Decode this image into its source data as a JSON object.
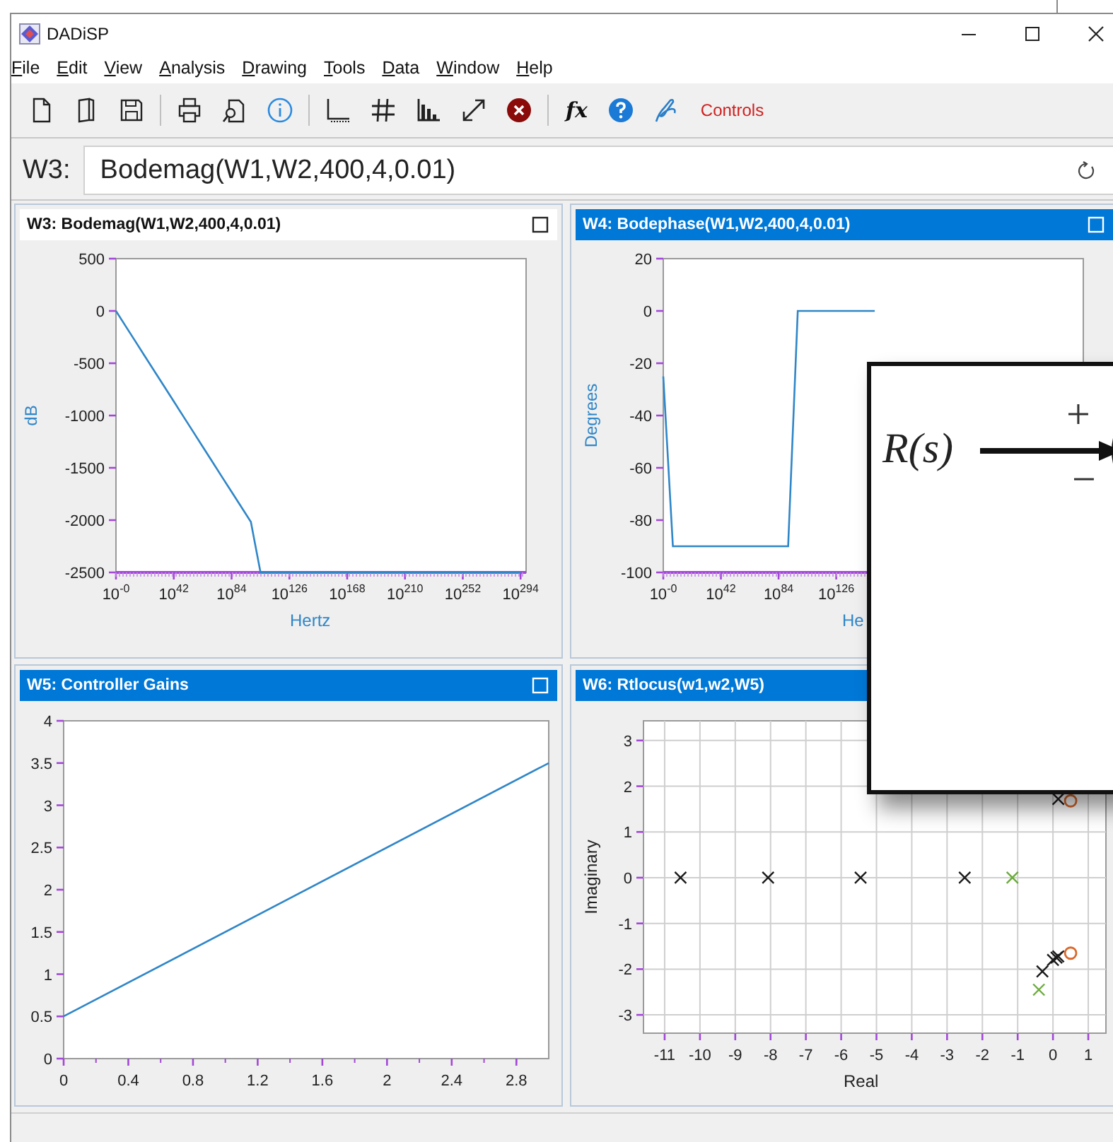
{
  "window": {
    "title": "DADiSP"
  },
  "menu": [
    "File",
    "Edit",
    "View",
    "Analysis",
    "Drawing",
    "Tools",
    "Data",
    "Window",
    "Help"
  ],
  "toolbar": {
    "function_label": "fx",
    "controls_label": "Controls"
  },
  "formula_bar": {
    "label": "W3:",
    "value": "Bodemag(W1,W2,400,4,0.01)"
  },
  "panes": [
    {
      "title": "W3: Bodemag(W1,W2,400,4,0.01)",
      "selected": true,
      "maximize_button": true,
      "chart_data": {
        "type": "line",
        "xlabel": "Hertz",
        "ylabel": "dB",
        "categories": [
          "10$^{-0}$",
          null,
          null,
          null,
          null,
          null,
          "10$^{42}$",
          null,
          null,
          null,
          null,
          null,
          "10$^{84}$",
          null,
          null,
          null,
          null,
          null,
          "10$^{126}$",
          null,
          null,
          null,
          null,
          null,
          "10$^{168}$",
          null,
          null,
          null,
          null,
          null,
          "10$^{210}$",
          null,
          null,
          null,
          null,
          null,
          "10$^{252}$",
          null,
          null,
          null,
          null,
          null,
          "10$^{294}$"
        ],
        "series": [
          {
            "color": "#2f86c8",
            "values": [
              0,
              -144,
              -288,
              -432,
              -576,
              -721,
              -865,
              -1009,
              -1153,
              -1297,
              -1441,
              -1585,
              -1729,
              -1873,
              -2017,
              -2500,
              -2500,
              -2500,
              -2500,
              -2500,
              -2500,
              -2500,
              -2500,
              -2500,
              -2500,
              -2500,
              -2500,
              -2500,
              -2500,
              -2500,
              -2500,
              -2500,
              -2500,
              -2500,
              -2500,
              -2500,
              -2500,
              -2500,
              -2500,
              -2500,
              -2500,
              -2500,
              -2500
            ]
          }
        ],
        "ylim": [
          -2500,
          500
        ],
        "yticks": [
          500,
          0,
          -500,
          -1000,
          -1500,
          -2000,
          -2500
        ]
      }
    },
    {
      "title": "W4: Bodephase(W1,W2,400,4,0.01)",
      "selected": false,
      "maximize_button": true,
      "chart_data": {
        "type": "line",
        "xlabel": "He",
        "ylabel": "Degrees",
        "categories": [
          "10$^{-0}$",
          null,
          null,
          null,
          null,
          null,
          "10$^{42}$",
          null,
          null,
          null,
          null,
          null,
          "10$^{84}$",
          null,
          null,
          null,
          null,
          null,
          "10$^{126}$",
          null,
          null,
          null,
          null,
          null,
          null,
          null,
          null,
          null,
          null,
          null,
          null,
          null,
          null,
          null,
          null,
          null,
          null,
          null,
          null,
          null,
          null,
          null,
          null,
          null
        ],
        "series": [
          {
            "color": "#2f86c8",
            "values": [
              -25,
              -90,
              -90,
              -90,
              -90,
              -90,
              -90,
              -90,
              -90,
              -90,
              -90,
              -90,
              -90,
              -90,
              0,
              0,
              0,
              0,
              0,
              0,
              0,
              0,
              0,
              null,
              null,
              null,
              null,
              null,
              null,
              null,
              null,
              null,
              null,
              null,
              null,
              null,
              null,
              null,
              null,
              null,
              null,
              null,
              null,
              null
            ]
          }
        ],
        "ylim": [
          -100,
          20
        ],
        "yticks": [
          20,
          0,
          -20,
          -40,
          -60,
          -80,
          -100
        ]
      }
    },
    {
      "title": "W5: Controller Gains",
      "selected": false,
      "maximize_button": true,
      "chart_data": {
        "type": "line",
        "x": [
          0,
          3
        ],
        "series": [
          {
            "color": "#2f86c8",
            "values": [
              0.5,
              3.5
            ]
          }
        ],
        "xlim": [
          0,
          3
        ],
        "ylim": [
          0,
          4
        ],
        "xticks": [
          0,
          0.4,
          0.8,
          1.2,
          1.6,
          2,
          2.4,
          2.8
        ],
        "yticks": [
          4,
          3.5,
          3,
          2.5,
          2,
          1.5,
          1,
          0.5,
          0
        ]
      }
    },
    {
      "title": "W6: Rtlocus(w1,w2,W5)",
      "selected": false,
      "maximize_button": false,
      "chart_data": {
        "type": "scatter",
        "xlabel": "Real",
        "ylabel": "Imaginary",
        "grid": true,
        "series": [
          {
            "marker": "x",
            "color": "#1a1a1a",
            "x": [
              -10.55,
              -8.07,
              -5.45,
              -2.5,
              -0.3,
              0,
              0.1,
              0.15,
              0.15
            ],
            "values": [
              0,
              0,
              0,
              0,
              -2.05,
              -1.8,
              -1.75,
              -1.72,
              1.72
            ]
          },
          {
            "marker": "x",
            "color": "#6aab3a",
            "x": [
              -1.15,
              -0.4
            ],
            "values": [
              0,
              -2.45
            ]
          },
          {
            "marker": "o",
            "color": "#d9692c",
            "x": [
              0.5,
              0.5
            ],
            "values": [
              -1.65,
              1.68
            ]
          }
        ],
        "xlim": [
          -11.6,
          1.5
        ],
        "ylim": [
          -3.4,
          3.43
        ],
        "xticks": [
          -11,
          -10,
          -9,
          -8,
          -7,
          -6,
          -5,
          -4,
          -3,
          -2,
          -1,
          0,
          1
        ],
        "yticks": [
          3,
          2,
          1,
          0,
          -1,
          -2,
          -3
        ]
      }
    }
  ],
  "diagram": {
    "input_label": "R(s)",
    "plus_sign": "+",
    "minus_sign": "−"
  }
}
